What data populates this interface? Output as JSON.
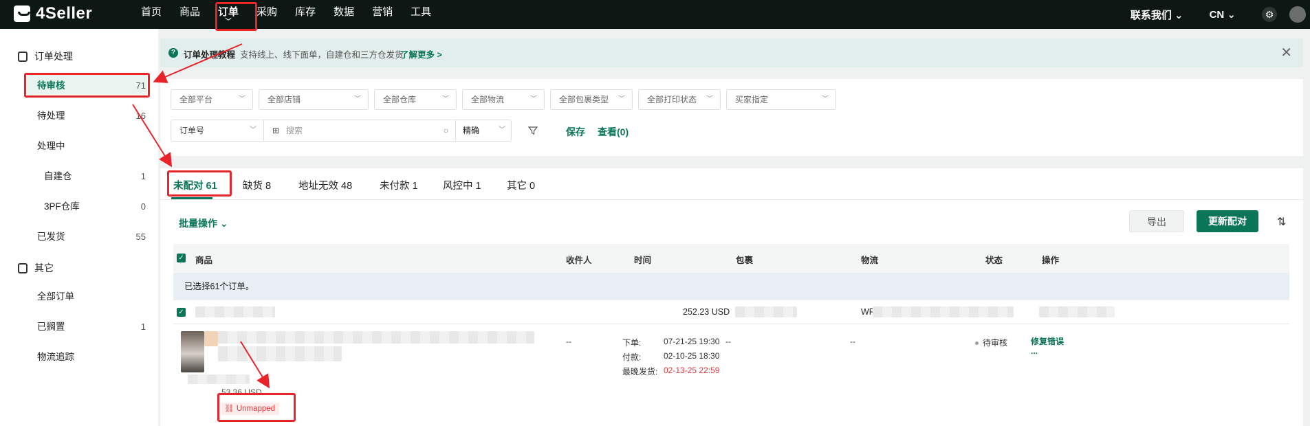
{
  "nav": {
    "brand": "4Seller",
    "items": [
      "首页",
      "商品",
      "订单",
      "采购",
      "库存",
      "数据",
      "营销",
      "工具"
    ],
    "active_index": 2,
    "contact": "联系我们",
    "lang": "CN"
  },
  "sidebar": {
    "group1": "订单处理",
    "items": [
      {
        "label": "待审核",
        "count": "71"
      },
      {
        "label": "待处理",
        "count": "16"
      },
      {
        "label": "处理中",
        "count": ""
      },
      {
        "label": "自建仓",
        "count": "1"
      },
      {
        "label": "3PF仓库",
        "count": "0"
      },
      {
        "label": "已发货",
        "count": "55"
      }
    ],
    "group2": "其它",
    "items2": [
      {
        "label": "全部订单",
        "count": ""
      },
      {
        "label": "已搁置",
        "count": "1"
      },
      {
        "label": "物流追踪",
        "count": ""
      }
    ]
  },
  "banner": {
    "title": "订单处理教程",
    "text": "支持线上、线下面单，自建仓和三方仓发货",
    "link": "了解更多 >"
  },
  "filters": {
    "selects": [
      "全部平台",
      "全部店铺",
      "全部仓库",
      "全部物流",
      "全部包裹类型",
      "全部打印状态",
      "买家指定"
    ],
    "field": "订单号",
    "search_placeholder": "搜索",
    "match": "精确",
    "save": "保存",
    "view": "查看(0)"
  },
  "tabs": [
    "未配对 61",
    "缺货 8",
    "地址无效 48",
    "未付款 1",
    "风控中 1",
    "其它 0"
  ],
  "toolbar": {
    "batch": "批量操作",
    "export": "导出",
    "update": "更新配对"
  },
  "table": {
    "columns": [
      "商品",
      "收件人",
      "时间",
      "包裹",
      "物流",
      "状态",
      "操作"
    ],
    "selected_text": "已选择61个订单。",
    "order": {
      "total": "252.23 USD",
      "logistics_prefix": "WF",
      "recipient": "--",
      "time_labels": [
        "下单:",
        "付款:",
        "最晚发货:"
      ],
      "time_values": [
        "07-21-25 19:30",
        "02-10-25 18:30",
        "02-13-25 22:59"
      ],
      "package": "--",
      "logistics": "--",
      "status": "待审核",
      "action": "修复错误",
      "more": "...",
      "item_price": "53.36 USD",
      "unmapped": "Unmapped"
    }
  }
}
